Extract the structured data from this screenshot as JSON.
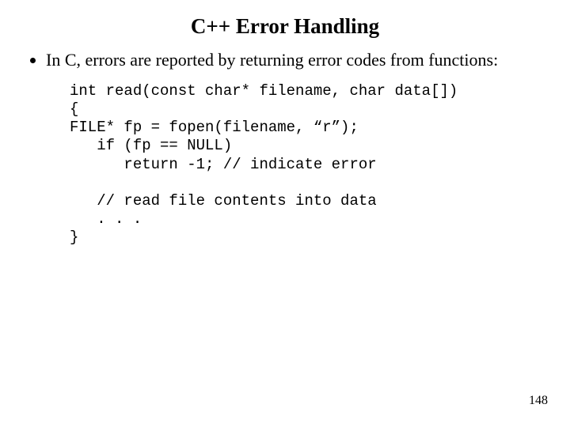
{
  "title": "C++ Error Handling",
  "bullet1": "In C, errors are reported by returning error codes from functions:",
  "code": {
    "l1": "int read(const char* filename, char data[])",
    "l2": "{",
    "l3": "FILE* fp = fopen(filename, “r”);",
    "l4": "   if (fp == NULL)",
    "l5": "      return -1; // indicate error",
    "l6": "",
    "l7": "   // read file contents into data",
    "l8": "   . . .",
    "l9": "}"
  },
  "page_number": "148"
}
